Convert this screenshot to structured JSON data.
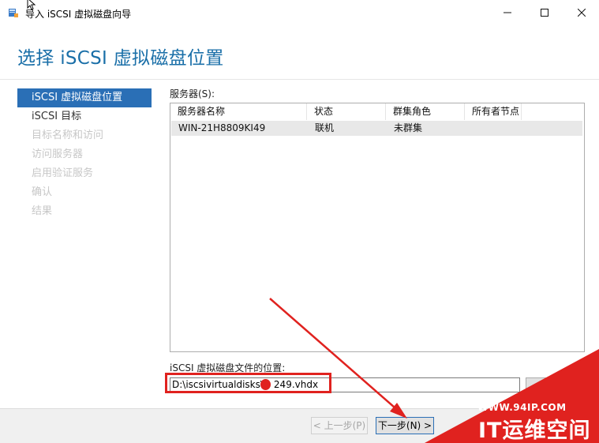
{
  "window": {
    "title": "导入 iSCSI 虚拟磁盘向导",
    "controls": {
      "minimize": "—",
      "maximize": "☐",
      "close": "✕"
    }
  },
  "page": {
    "title": "选择 iSCSI 虚拟磁盘位置"
  },
  "nav": {
    "items": [
      {
        "label": "iSCSI 虚拟磁盘位置",
        "state": "active"
      },
      {
        "label": "iSCSI 目标",
        "state": "enabled"
      },
      {
        "label": "目标名称和访问",
        "state": "disabled"
      },
      {
        "label": "访问服务器",
        "state": "disabled"
      },
      {
        "label": "启用验证服务",
        "state": "disabled"
      },
      {
        "label": "确认",
        "state": "disabled"
      },
      {
        "label": "结果",
        "state": "disabled"
      }
    ]
  },
  "servers": {
    "label": "服务器(S):",
    "columns": [
      "服务器名称",
      "状态",
      "群集角色",
      "所有者节点"
    ],
    "rows": [
      [
        "WIN-21H8809KI49",
        "联机",
        "未群集",
        ""
      ]
    ]
  },
  "vhd_location": {
    "label": "iSCSI 虚拟磁盘文件的位置:",
    "value_prefix": "D:\\iscsivirtualdisks\\",
    "value_suffix": "249.vhdx",
    "browse_label": "..."
  },
  "footer": {
    "prev_label": "< 上一步(P)",
    "next_label": "下一步(N) >"
  },
  "watermark": {
    "url": "WWW.94IP.COM",
    "name": "IT运维空间"
  },
  "colors": {
    "title_blue": "#1a6fa8",
    "nav_active": "#2a6fb6",
    "annotation_red": "#e0221f"
  }
}
